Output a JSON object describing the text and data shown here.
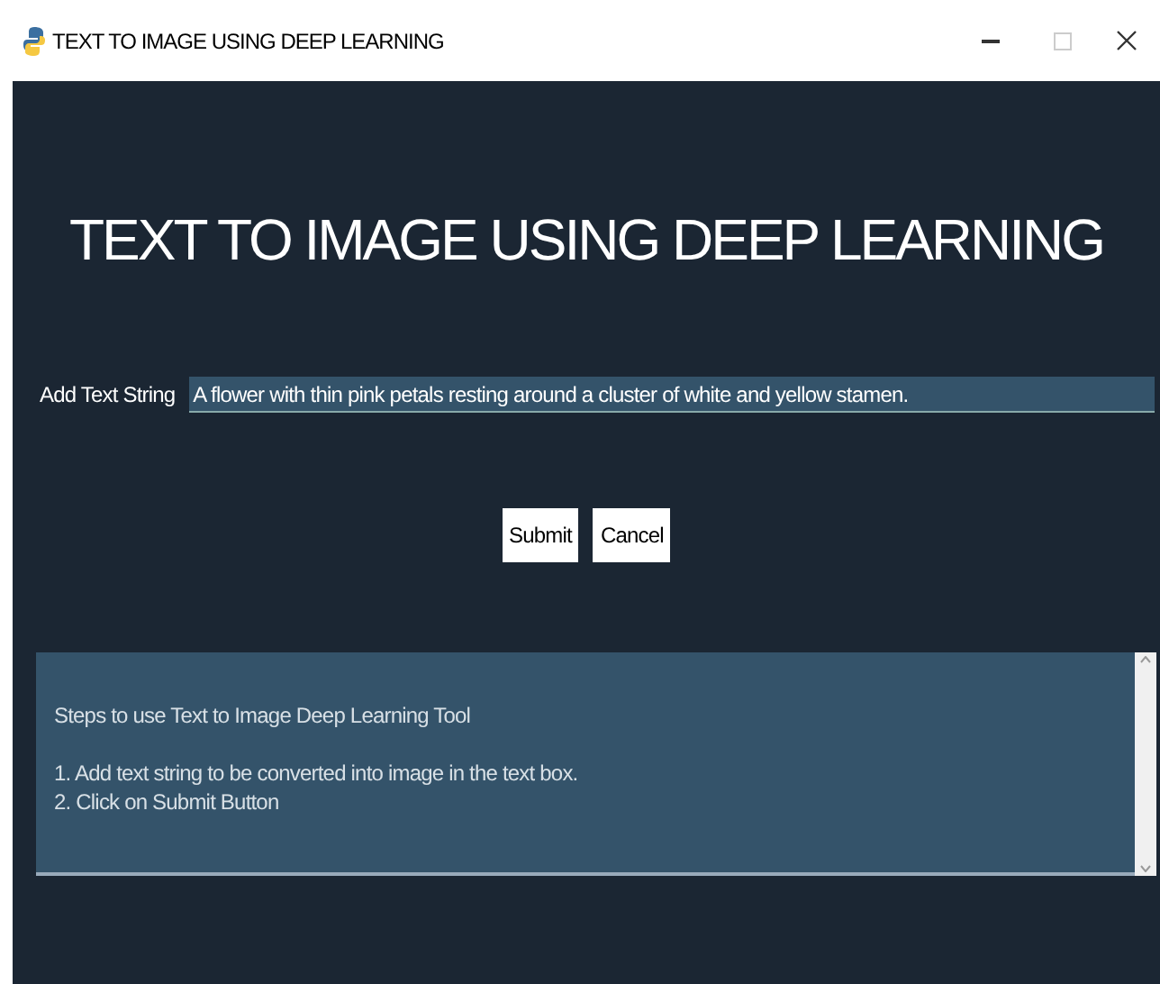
{
  "window": {
    "title": "TEXT TO IMAGE USING DEEP LEARNING"
  },
  "heading": "TEXT TO IMAGE USING DEEP LEARNING",
  "input": {
    "label": "Add Text String",
    "value": "A flower with thin pink petals resting around a cluster of white and yellow stamen."
  },
  "buttons": [
    "Submit",
    "Cancel"
  ],
  "instructions": {
    "title": "Steps to use Text to Image Deep Learning Tool",
    "steps": [
      "1. Add text string to be converted into image in the text box.",
      "2. Click on Submit Button"
    ]
  }
}
